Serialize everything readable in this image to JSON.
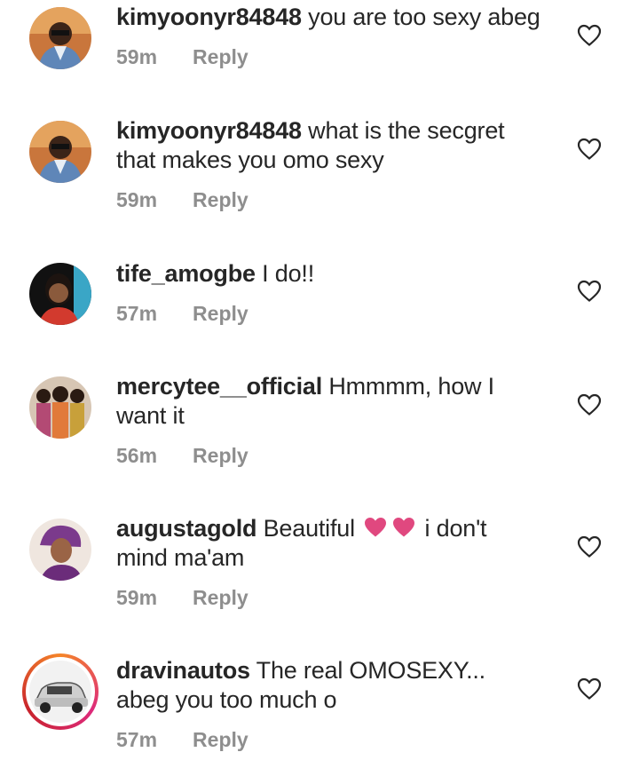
{
  "comments": [
    {
      "username": "kimyoonyr84848",
      "text": "you are too sexy abeg",
      "time": "59m",
      "reply": "Reply",
      "avatar": "avatar-man-sunglasses"
    },
    {
      "username": "kimyoonyr84848",
      "text": "what is the secgret that makes you omo sexy",
      "time": "59m",
      "reply": "Reply",
      "avatar": "avatar-man-sunglasses"
    },
    {
      "username": "tife_amogbe",
      "text": "I do!!",
      "time": "57m",
      "reply": "Reply",
      "avatar": "avatar-woman-red"
    },
    {
      "username": "mercytee__official",
      "text": "Hmmmm, how I want it",
      "time": "56m",
      "reply": "Reply",
      "avatar": "avatar-group-women"
    },
    {
      "username": "augustagold",
      "text_before": "Beautiful",
      "text_after": "i don't mind ma'am",
      "emoji": "pink-heart-icon",
      "time": "59m",
      "reply": "Reply",
      "avatar": "avatar-woman-headwrap"
    },
    {
      "username": "dravinautos",
      "text": "The real OMOSEXY... abeg you too much o",
      "time": "57m",
      "reply": "Reply",
      "avatar": "avatar-car",
      "has_story": true
    }
  ],
  "colors": {
    "text": "#262626",
    "meta": "#8e8e8e",
    "heart_emoji": "#e0487f"
  }
}
